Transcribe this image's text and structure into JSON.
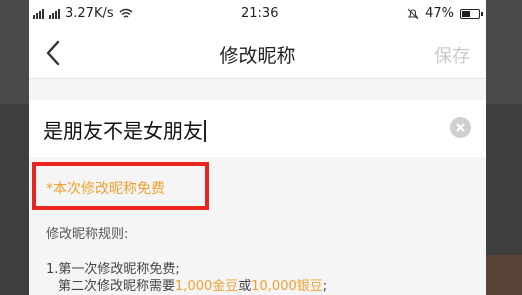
{
  "status": {
    "signal_text": "(no)",
    "speed": "3.27K/s",
    "time": "21:36",
    "battery": "47%"
  },
  "navbar": {
    "title": "修改昵称",
    "save_label": "保存"
  },
  "input": {
    "value": "是朋友不是女朋友"
  },
  "notice": {
    "free_text": "*本次修改昵称免费"
  },
  "rules": {
    "title": "修改昵称规则:",
    "line1": "1.第一次修改昵称免费;",
    "line2_prefix": "第二次修改昵称需要",
    "gold": "1,000金豆",
    "or": "或",
    "silver": "10,000银豆",
    "line2_suffix": ";"
  },
  "colors": {
    "accent": "#f0a030",
    "highlight": "#e8261f"
  }
}
